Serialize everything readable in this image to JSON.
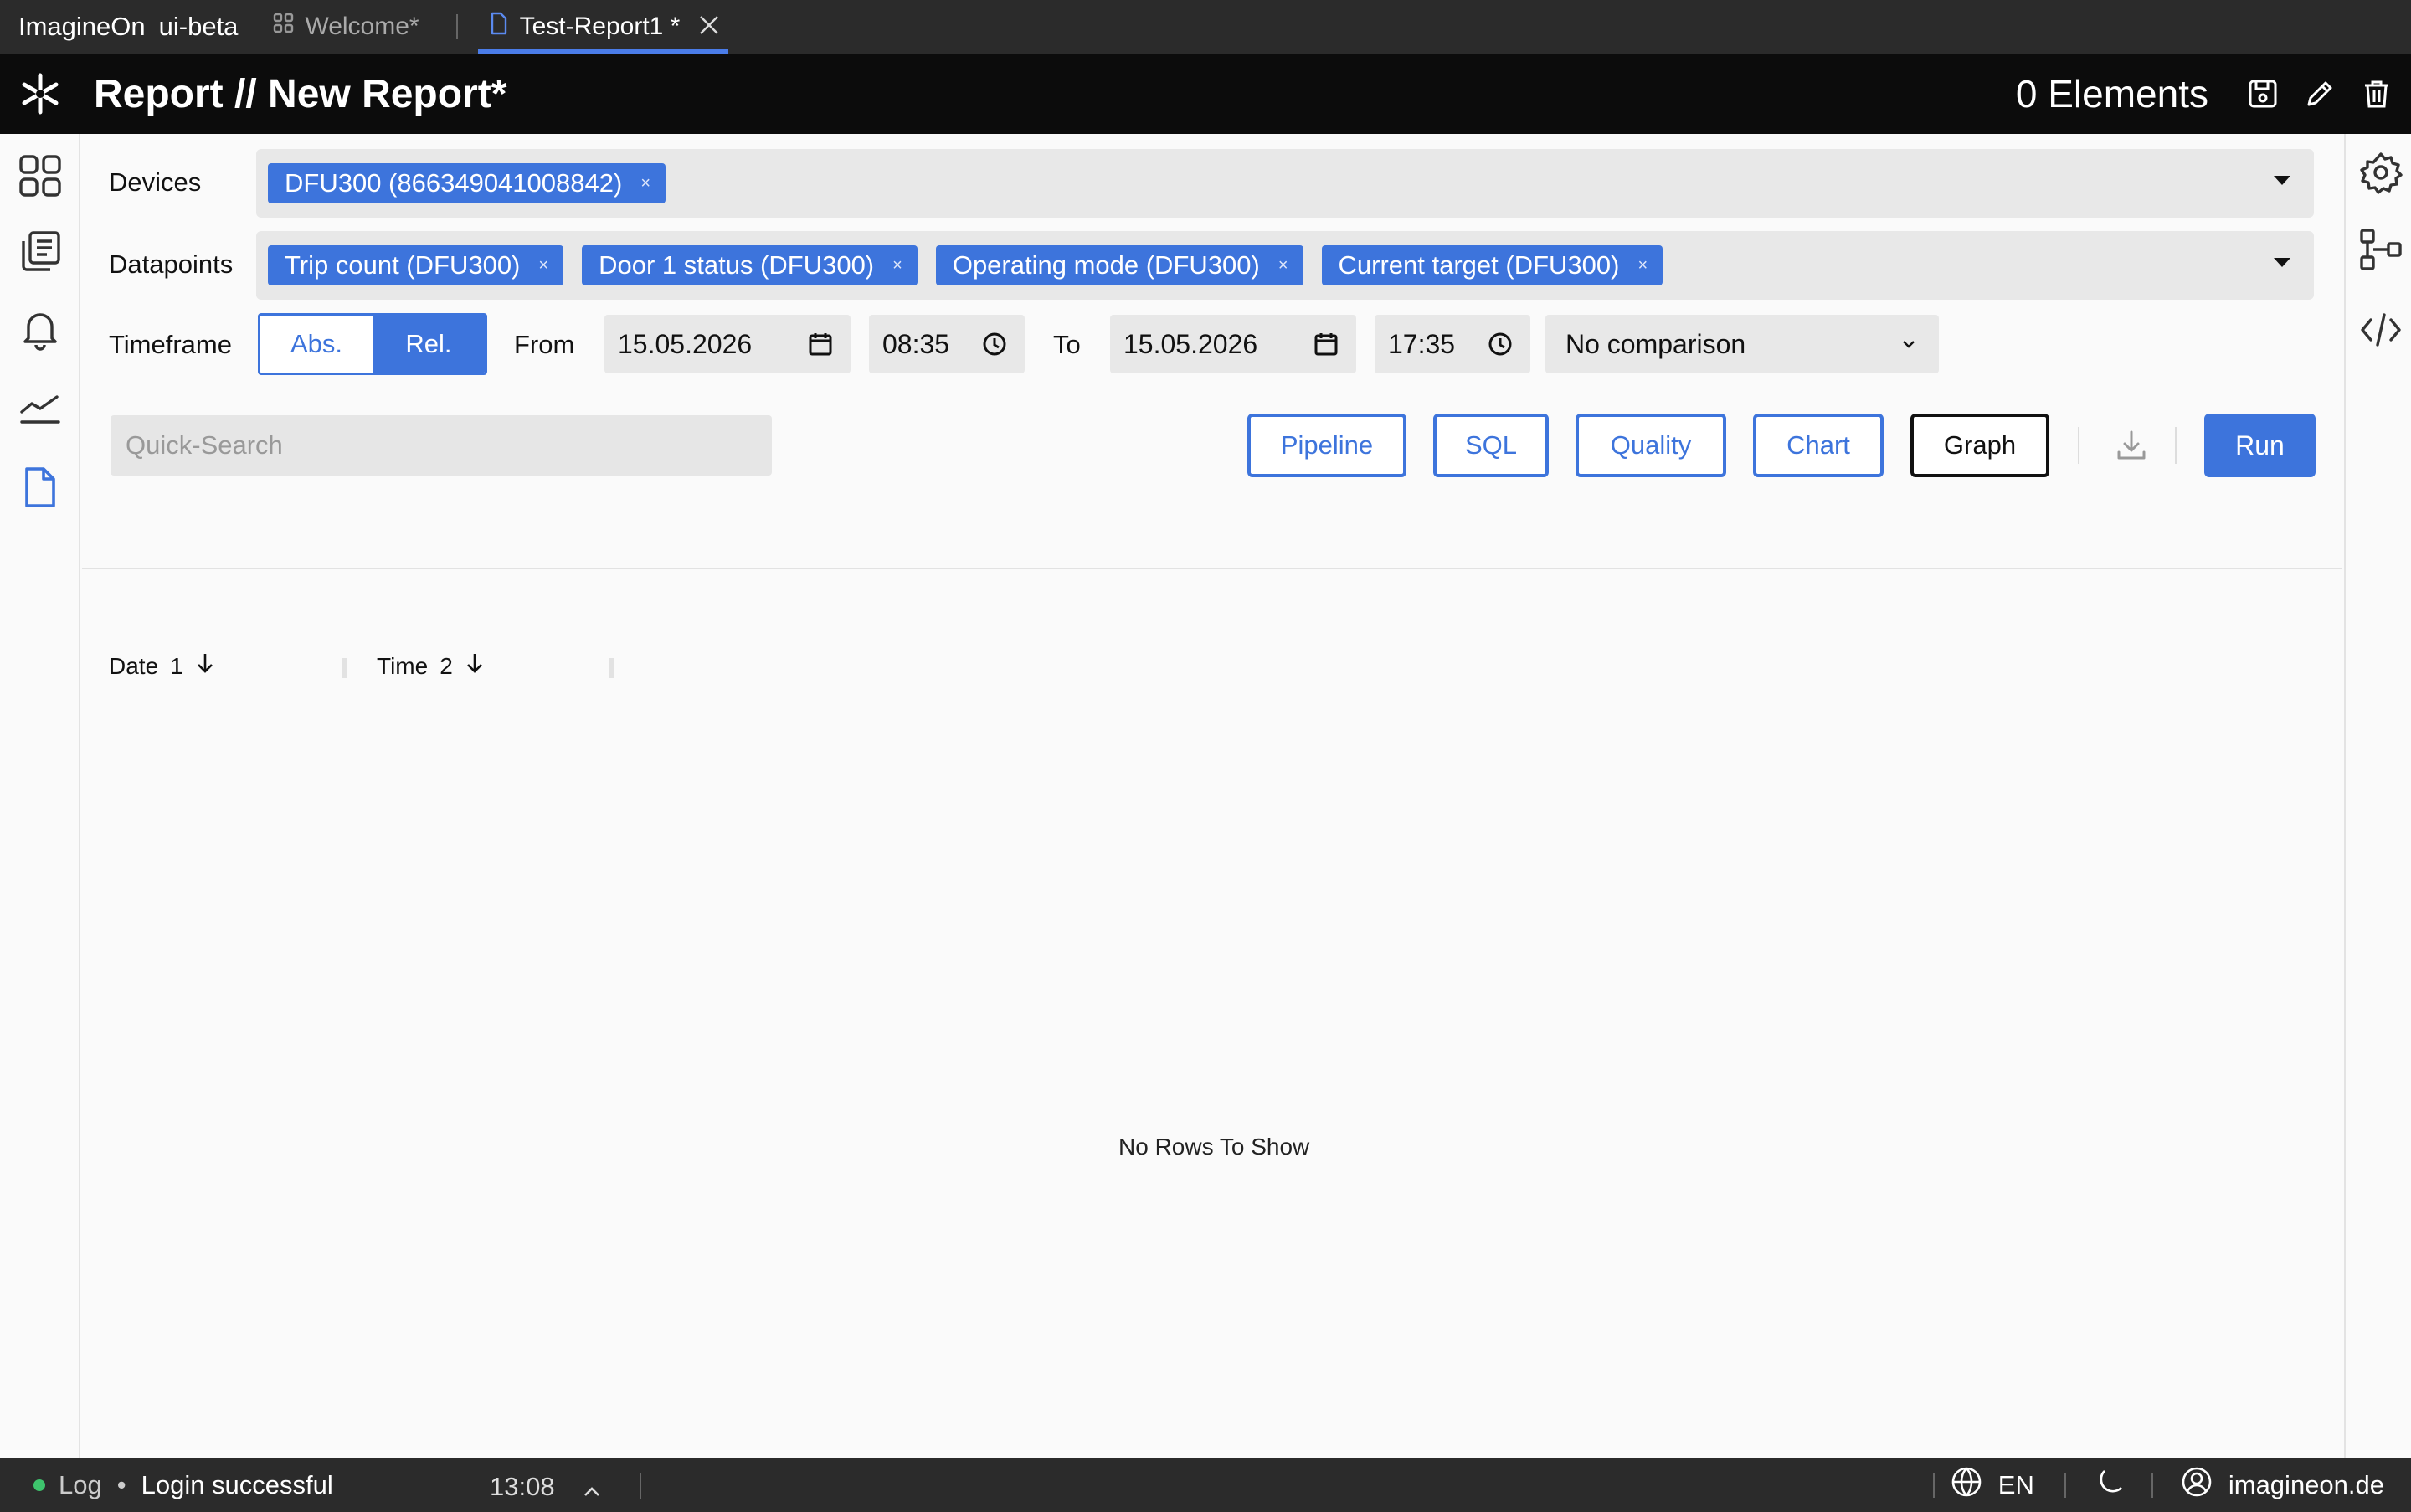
{
  "app": {
    "name": "ImagineOn",
    "env": "ui-beta"
  },
  "tabs": [
    {
      "label": "Welcome*"
    },
    {
      "label": "Test-Report1 *"
    }
  ],
  "header": {
    "section": "Report",
    "separator": "//",
    "title": "New Report*",
    "elements_count": "0 Elements"
  },
  "filters": {
    "devices_label": "Devices",
    "devices": [
      "DFU300 (866349041008842)"
    ],
    "datapoints_label": "Datapoints",
    "datapoints": [
      "Trip count (DFU300)",
      "Door 1 status (DFU300)",
      "Operating mode (DFU300)",
      "Current target (DFU300)"
    ],
    "chip_remove": "×",
    "timeframe_label": "Timeframe",
    "timeframe_abs": "Abs.",
    "timeframe_rel": "Rel.",
    "timeframe_selected": "Rel.",
    "from_label": "From",
    "from_date": "15.05.2026",
    "from_time": "08:35",
    "to_label": "To",
    "to_date": "15.05.2026",
    "to_time": "17:35",
    "comparison": "No comparison"
  },
  "toolbar": {
    "search_placeholder": "Quick-Search",
    "buttons": [
      "Pipeline",
      "SQL",
      "Quality",
      "Chart",
      "Graph"
    ],
    "run": "Run"
  },
  "table": {
    "columns": [
      {
        "label": "Date",
        "sort_index": "1"
      },
      {
        "label": "Time",
        "sort_index": "2"
      }
    ],
    "empty_message": "No Rows To Show"
  },
  "status": {
    "log_label": "Log",
    "bullet": "•",
    "message": "Login successful",
    "time": "13:08",
    "language": "EN",
    "account": "imagineon.de"
  },
  "colors": {
    "accent": "#3d74dc",
    "dark": "#0c0c0c",
    "bar": "#2b2b2b",
    "status_dot": "#3ec46d"
  }
}
